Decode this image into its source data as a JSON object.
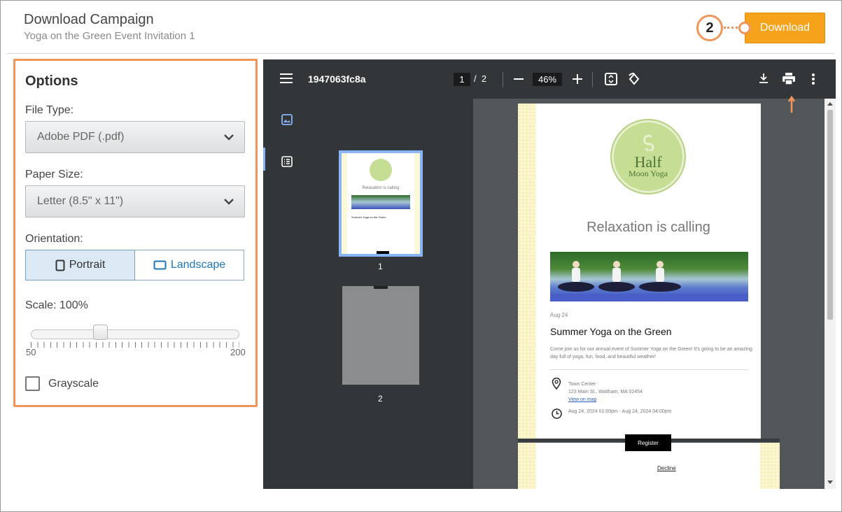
{
  "header": {
    "title": "Download Campaign",
    "subtitle": "Yoga on the Green Event Invitation 1",
    "download_label": "Download",
    "callout_number": "2"
  },
  "options": {
    "heading": "Options",
    "file_type_label": "File Type:",
    "file_type_value": "Adobe PDF (.pdf)",
    "paper_size_label": "Paper Size:",
    "paper_size_value": "Letter (8.5\" x 11\")",
    "orientation_label": "Orientation:",
    "orientation_portrait": "Portrait",
    "orientation_landscape": "Landscape",
    "orientation_selected": "Portrait",
    "scale_label": "Scale: 100%",
    "scale_value": 100,
    "scale_min": "50",
    "scale_max": "200",
    "grayscale_label": "Grayscale",
    "grayscale_checked": false
  },
  "viewer": {
    "file_name": "1947063fc8a",
    "current_page": "1",
    "page_sep": "/",
    "total_pages": "2",
    "zoom": "46%",
    "thumb_labels": [
      "1",
      "2"
    ],
    "thumb1_title": "Relaxation is calling",
    "thumb1_event": "Summer Yoga on the Green",
    "toolbar_color": "#323639",
    "accent": "#8ab4f8"
  },
  "document": {
    "logo_line1": "Half",
    "logo_line2": "Moon Yoga",
    "headline": "Relaxation is calling",
    "date": "Aug 24",
    "event_title": "Summer Yoga on the Green",
    "body": "Come join us for our annual event of Summer Yoga on the Green! It's going to be an amazing day full of yoga, fun, food, and beautiful weather!",
    "location_name": "Town Center",
    "location_address": "123 Main St., Waltham, MA 02454",
    "map_link": "View on map",
    "time": "Aug 24, 2024 01:00pm - Aug 24, 2024 04:00pm",
    "register": "Register",
    "decline": "Decline"
  },
  "colors": {
    "download_button": "#f7a21b",
    "callout": "#f0955a",
    "logo_green": "#c5de93"
  }
}
